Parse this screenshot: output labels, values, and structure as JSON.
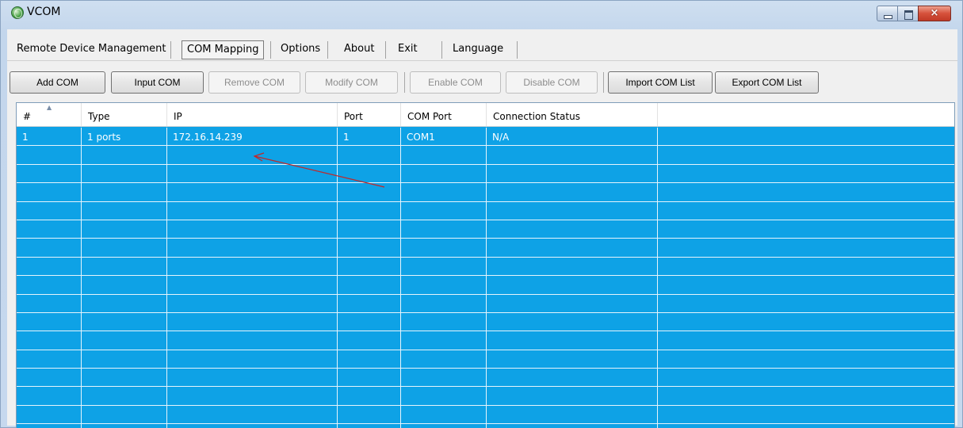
{
  "window": {
    "title": "VCOM",
    "icon": "globe-icon",
    "caption_close": "×"
  },
  "menu": {
    "items": [
      {
        "label": "Remote Device Management"
      },
      {
        "label": "COM Mapping",
        "active": true
      },
      {
        "label": "Options"
      },
      {
        "label": "About"
      },
      {
        "label": "Exit"
      },
      {
        "label": "Language"
      }
    ]
  },
  "toolbar": {
    "add_com": "Add COM",
    "input_com": "Input COM",
    "remove_com": "Remove COM",
    "modify_com": "Modify COM",
    "enable_com": "Enable COM",
    "disable_com": "Disable COM",
    "import_com_list": "Import COM List",
    "export_com_list": "Export COM List"
  },
  "table": {
    "columns": [
      "#",
      "Type",
      "IP",
      "Port",
      "COM Port",
      "Connection Status"
    ],
    "rows": [
      [
        "1",
        "1 ports",
        "172.16.14.239",
        "1",
        "COM1",
        "N/A"
      ]
    ],
    "selection_color": "#0ea2e6"
  }
}
